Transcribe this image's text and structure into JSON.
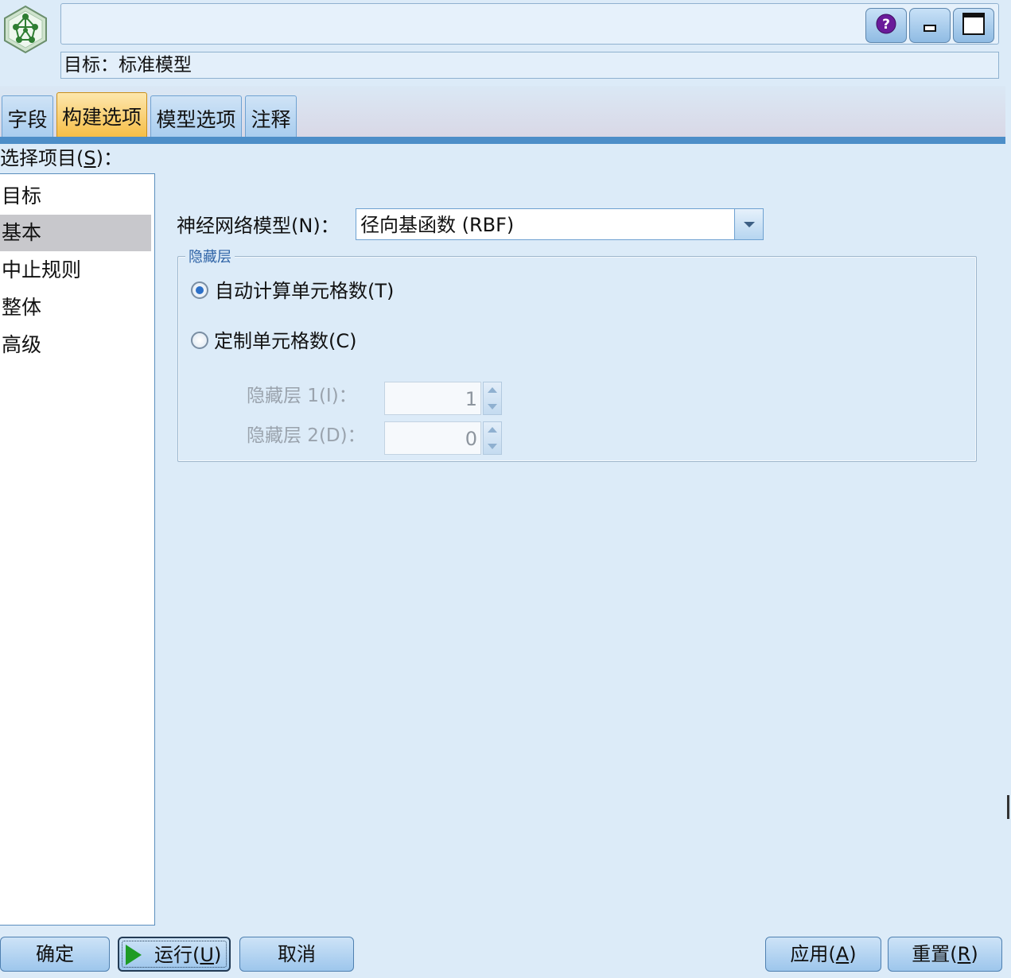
{
  "header": {
    "target_label": "目标：",
    "target_value": "标准模型",
    "icons": {
      "app": "neural-network-node-icon",
      "help": "help-icon",
      "minimize": "minimize-icon",
      "maximize": "maximize-icon"
    }
  },
  "tabs": [
    {
      "label": "字段"
    },
    {
      "label": "构建选项",
      "active": true
    },
    {
      "label": "模型选项"
    },
    {
      "label": "注释"
    }
  ],
  "sidebar": {
    "select_label_prefix": "选择项目(",
    "select_label_key": "S",
    "select_label_suffix": ")：",
    "items": [
      {
        "label": "目标"
      },
      {
        "label": "基本",
        "selected": true
      },
      {
        "label": "中止规则"
      },
      {
        "label": "整体"
      },
      {
        "label": "高级"
      }
    ]
  },
  "main": {
    "nn_model_label": "神经网络模型(N)：",
    "nn_model_value": "径向基函数 (RBF)",
    "hidden_group_label": "隐藏层",
    "radio_auto": {
      "label": "自动计算单元格数(T)",
      "checked": true
    },
    "radio_custom": {
      "label": "定制单元格数(C)",
      "checked": false
    },
    "hidden1": {
      "label": "隐藏层 1(I)：",
      "value": "1"
    },
    "hidden2": {
      "label": "隐藏层 2(D)：",
      "value": "0"
    }
  },
  "footer": {
    "ok_label": "确定",
    "run_label_prefix": "运行(",
    "run_label_key": "U",
    "run_label_suffix": ")",
    "cancel_label": "取消",
    "apply_label_prefix": "应用(",
    "apply_label_key": "A",
    "apply_label_suffix": ")",
    "reset_label_prefix": "重置(",
    "reset_label_key": "R",
    "reset_label_suffix": ")"
  },
  "colors": {
    "background": "#dcebf8",
    "active_tab": "#f6bb3f",
    "tab_underline": "#4d8ec8",
    "selected_item": "#c8c8cc",
    "run_icon": "#1e9b25"
  }
}
